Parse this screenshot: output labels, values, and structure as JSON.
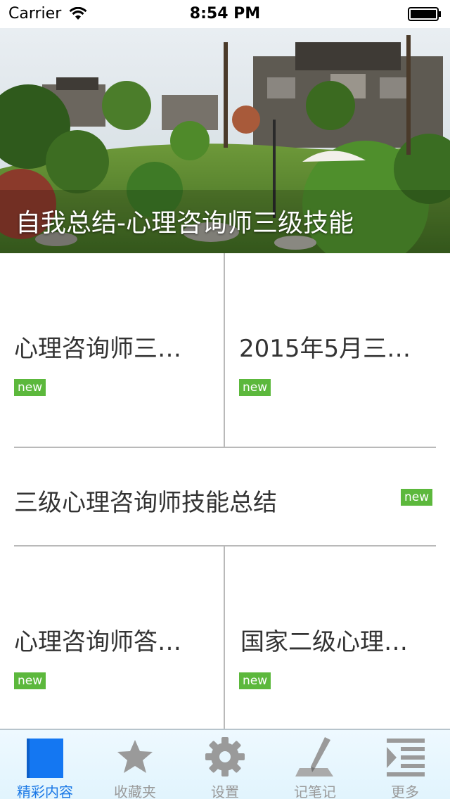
{
  "status_bar": {
    "carrier": "Carrier",
    "time": "8:54 PM"
  },
  "hero": {
    "title": "自我总结-心理咨询师三级技能"
  },
  "articles": [
    {
      "title": "心理咨询师三…",
      "badge": "new"
    },
    {
      "title": "2015年5月三…",
      "badge": "new"
    },
    {
      "title": "三级心理咨询师技能总结",
      "badge": "new"
    },
    {
      "title": "心理咨询师答…",
      "badge": "new"
    },
    {
      "title": "国家二级心理…",
      "badge": "new"
    }
  ],
  "tab_bar": {
    "tabs": [
      {
        "label": "精彩内容",
        "icon": "book-icon",
        "active": true
      },
      {
        "label": "收藏夹",
        "icon": "star-icon",
        "active": false
      },
      {
        "label": "设置",
        "icon": "gear-icon",
        "active": false
      },
      {
        "label": "记笔记",
        "icon": "pen-icon",
        "active": false
      },
      {
        "label": "更多",
        "icon": "list-icon",
        "active": false
      }
    ]
  },
  "colors": {
    "badge": "#5cb83c",
    "active_tab": "#1a78e6",
    "inactive_tab": "#9a9a9a"
  }
}
